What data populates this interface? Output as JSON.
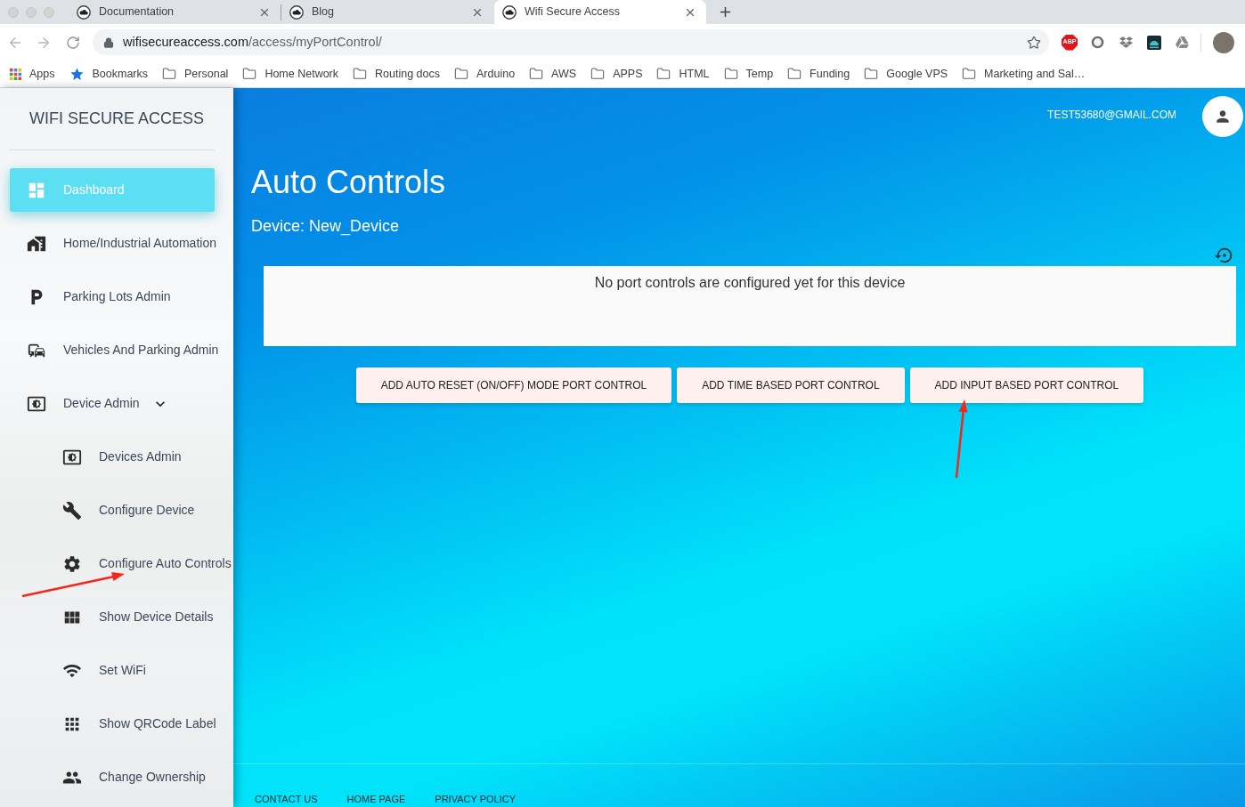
{
  "browser": {
    "tabs": [
      {
        "title": "Documentation",
        "selected": false
      },
      {
        "title": "Blog",
        "selected": false
      },
      {
        "title": "Wifi Secure Access",
        "selected": true
      }
    ],
    "url": {
      "host": "wifisecureaccess.com",
      "path": "/access/myPortControl/"
    },
    "extension_badge": "ABP",
    "bookmarks": [
      {
        "kind": "apps",
        "label": "Apps"
      },
      {
        "kind": "star",
        "label": "Bookmarks"
      },
      {
        "kind": "folder",
        "label": "Personal"
      },
      {
        "kind": "folder",
        "label": "Home Network"
      },
      {
        "kind": "folder",
        "label": "Routing docs"
      },
      {
        "kind": "folder",
        "label": "Arduino"
      },
      {
        "kind": "folder",
        "label": "AWS"
      },
      {
        "kind": "folder",
        "label": "APPS"
      },
      {
        "kind": "folder",
        "label": "HTML"
      },
      {
        "kind": "folder",
        "label": "Temp"
      },
      {
        "kind": "folder",
        "label": "Funding"
      },
      {
        "kind": "folder",
        "label": "Google VPS"
      },
      {
        "kind": "folder",
        "label": "Marketing and Sal…"
      }
    ]
  },
  "sidebar": {
    "brand": "WIFI SECURE ACCESS",
    "items": [
      {
        "label": "Dashboard",
        "selected": true
      },
      {
        "label": "Home/Industrial Automation",
        "selected": false
      },
      {
        "label": "Parking Lots Admin",
        "selected": false
      },
      {
        "label": "Vehicles And Parking Admin",
        "selected": false
      },
      {
        "label": "Device Admin",
        "selected": false,
        "expanded": true,
        "children": [
          {
            "label": "Devices Admin",
            "selected": false
          },
          {
            "label": "Configure Device",
            "selected": false
          },
          {
            "label": "Configure Auto Controls",
            "selected": false
          },
          {
            "label": "Show Device Details",
            "selected": false
          },
          {
            "label": "Set WiFi",
            "selected": false
          },
          {
            "label": "Show QRCode Label",
            "selected": false
          },
          {
            "label": "Change Ownership",
            "selected": false
          }
        ]
      }
    ]
  },
  "main": {
    "account": "TEST53680@GMAIL.COM",
    "title": "Auto Controls",
    "subtitle": "Device: New_Device",
    "empty_message": "No port controls are configured yet for this device",
    "buttons": [
      "ADD AUTO RESET (ON/OFF) MODE PORT CONTROL",
      "ADD TIME BASED PORT CONTROL",
      "ADD INPUT BASED PORT CONTROL"
    ],
    "footer_links": [
      "CONTACT US",
      "HOME PAGE",
      "PRIVACY POLICY"
    ]
  }
}
